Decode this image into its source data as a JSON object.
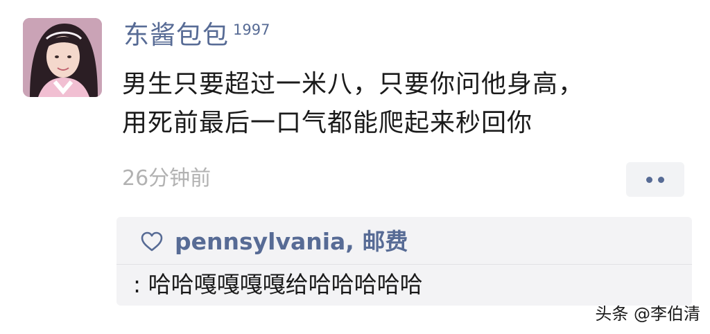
{
  "post": {
    "author": {
      "name": "东酱包包",
      "tag": "1997",
      "avatar_icon": "profile-photo"
    },
    "text_lines": [
      "男生只要超过一米八，只要你问他身高，",
      "用死前最后一口气都能爬起来秒回你"
    ],
    "time": "26分钟前",
    "more_icon": "two-dot-menu-icon"
  },
  "interactions": {
    "like_icon": "heart-outline-icon",
    "likes": "pennsylvania, 邮费",
    "comment": ": 哈哈嘎嘎嘎嘎给哈哈哈哈哈"
  },
  "watermark": "头条 @李伯清",
  "colors": {
    "link": "#576b95",
    "text": "#1a1a1a",
    "muted": "#b2b2b2",
    "panel": "#f3f3f5"
  }
}
